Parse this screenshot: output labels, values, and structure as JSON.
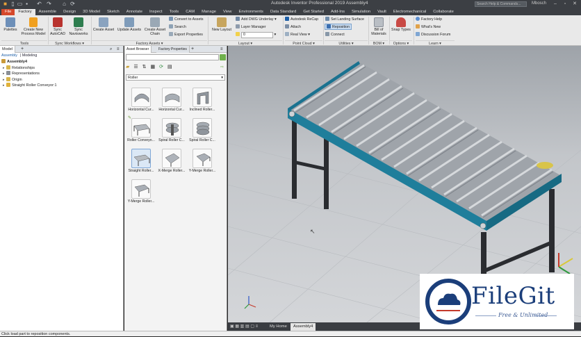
{
  "window": {
    "title": "Autodesk Inventor Professional 2019   Assembly4",
    "search_placeholder": "Search Help & Commands...",
    "user": "Mbosch"
  },
  "tabs": [
    "File",
    "Factory",
    "Assemble",
    "Design",
    "3D Model",
    "Sketch",
    "Annotate",
    "Inspect",
    "Tools",
    "CAM",
    "Manage",
    "View",
    "Environments",
    "Data Standard",
    "Get Started",
    "Add-Ins",
    "Simulation",
    "Vault",
    "Electromechanical",
    "Collaborate"
  ],
  "ribbon": {
    "palettes": "Palettes",
    "create_new_process_model": "Create New Process Model",
    "sync_autocad": "Sync AutoCAD",
    "sync_navisworks": "Sync Navisworks",
    "create_asset": "Create Asset",
    "update_assets": "Update Assets",
    "create_asset_chain": "Create Asset Chain",
    "convert_to_assets": "Convert to Assets",
    "search": "Search",
    "export_properties": "Export Properties",
    "new_layout": "New Layout",
    "add_dwg_underlay": "Add DWG Underlay",
    "layer_manager": "Layer Manager",
    "layer_value": "0",
    "autodesk_recap": "Autodesk ReCap",
    "attach": "Attach",
    "real_view": "Real View",
    "set_landing_surface": "Set Landing Surface",
    "reposition": "Reposition",
    "connect": "Connect",
    "bill_of_materials": "Bill of Materials",
    "snap_types": "Snap Types",
    "factory_help": "Factory Help",
    "whats_new": "What's New",
    "discussion_forum": "Discussion Forum",
    "groups": {
      "tools": "Tools",
      "sync_workflows": "Sync Workflows ▾",
      "factory_assets": "Factory Assets ▾",
      "layout": "Layout ▾",
      "point_cloud": "Point Cloud ▾",
      "utilities": "Utilities ▾",
      "bom": "BOM ▾",
      "options": "Options ▾",
      "learn": "Learn ▾"
    }
  },
  "model_panel": {
    "tab": "Model",
    "subtabs": [
      "Assembly",
      "Modeling"
    ],
    "tree": [
      "Assembly4",
      "Relationships",
      "Representations",
      "Origin",
      "Straight Roller Conveyor:1"
    ]
  },
  "asset_panel": {
    "tabs": [
      "Asset Browser",
      "Factory Properties"
    ],
    "category": "Roller",
    "assets": [
      "Horizontal Cur...",
      "Horizontal Cur...",
      "Inclined Roller...",
      "Roller Conveyo...",
      "Spiral Roller C...",
      "Spiral Roller C...",
      "Straight Roller...",
      "X-Merge Roller...",
      "Y-Merge Roller...",
      "Y-Merge Roller..."
    ]
  },
  "viewport_tabs": [
    "My Home",
    "Assembly4"
  ],
  "status": "Click load part to reposition components.",
  "watermark": {
    "brand": "FileGit",
    "tagline": "Free & Unlimited"
  },
  "colors": {
    "file_tab": "#d5482a",
    "conveyor_frame": "#1f7e9b",
    "legs": "#2a2c30",
    "rollers": "#a9adb2"
  }
}
